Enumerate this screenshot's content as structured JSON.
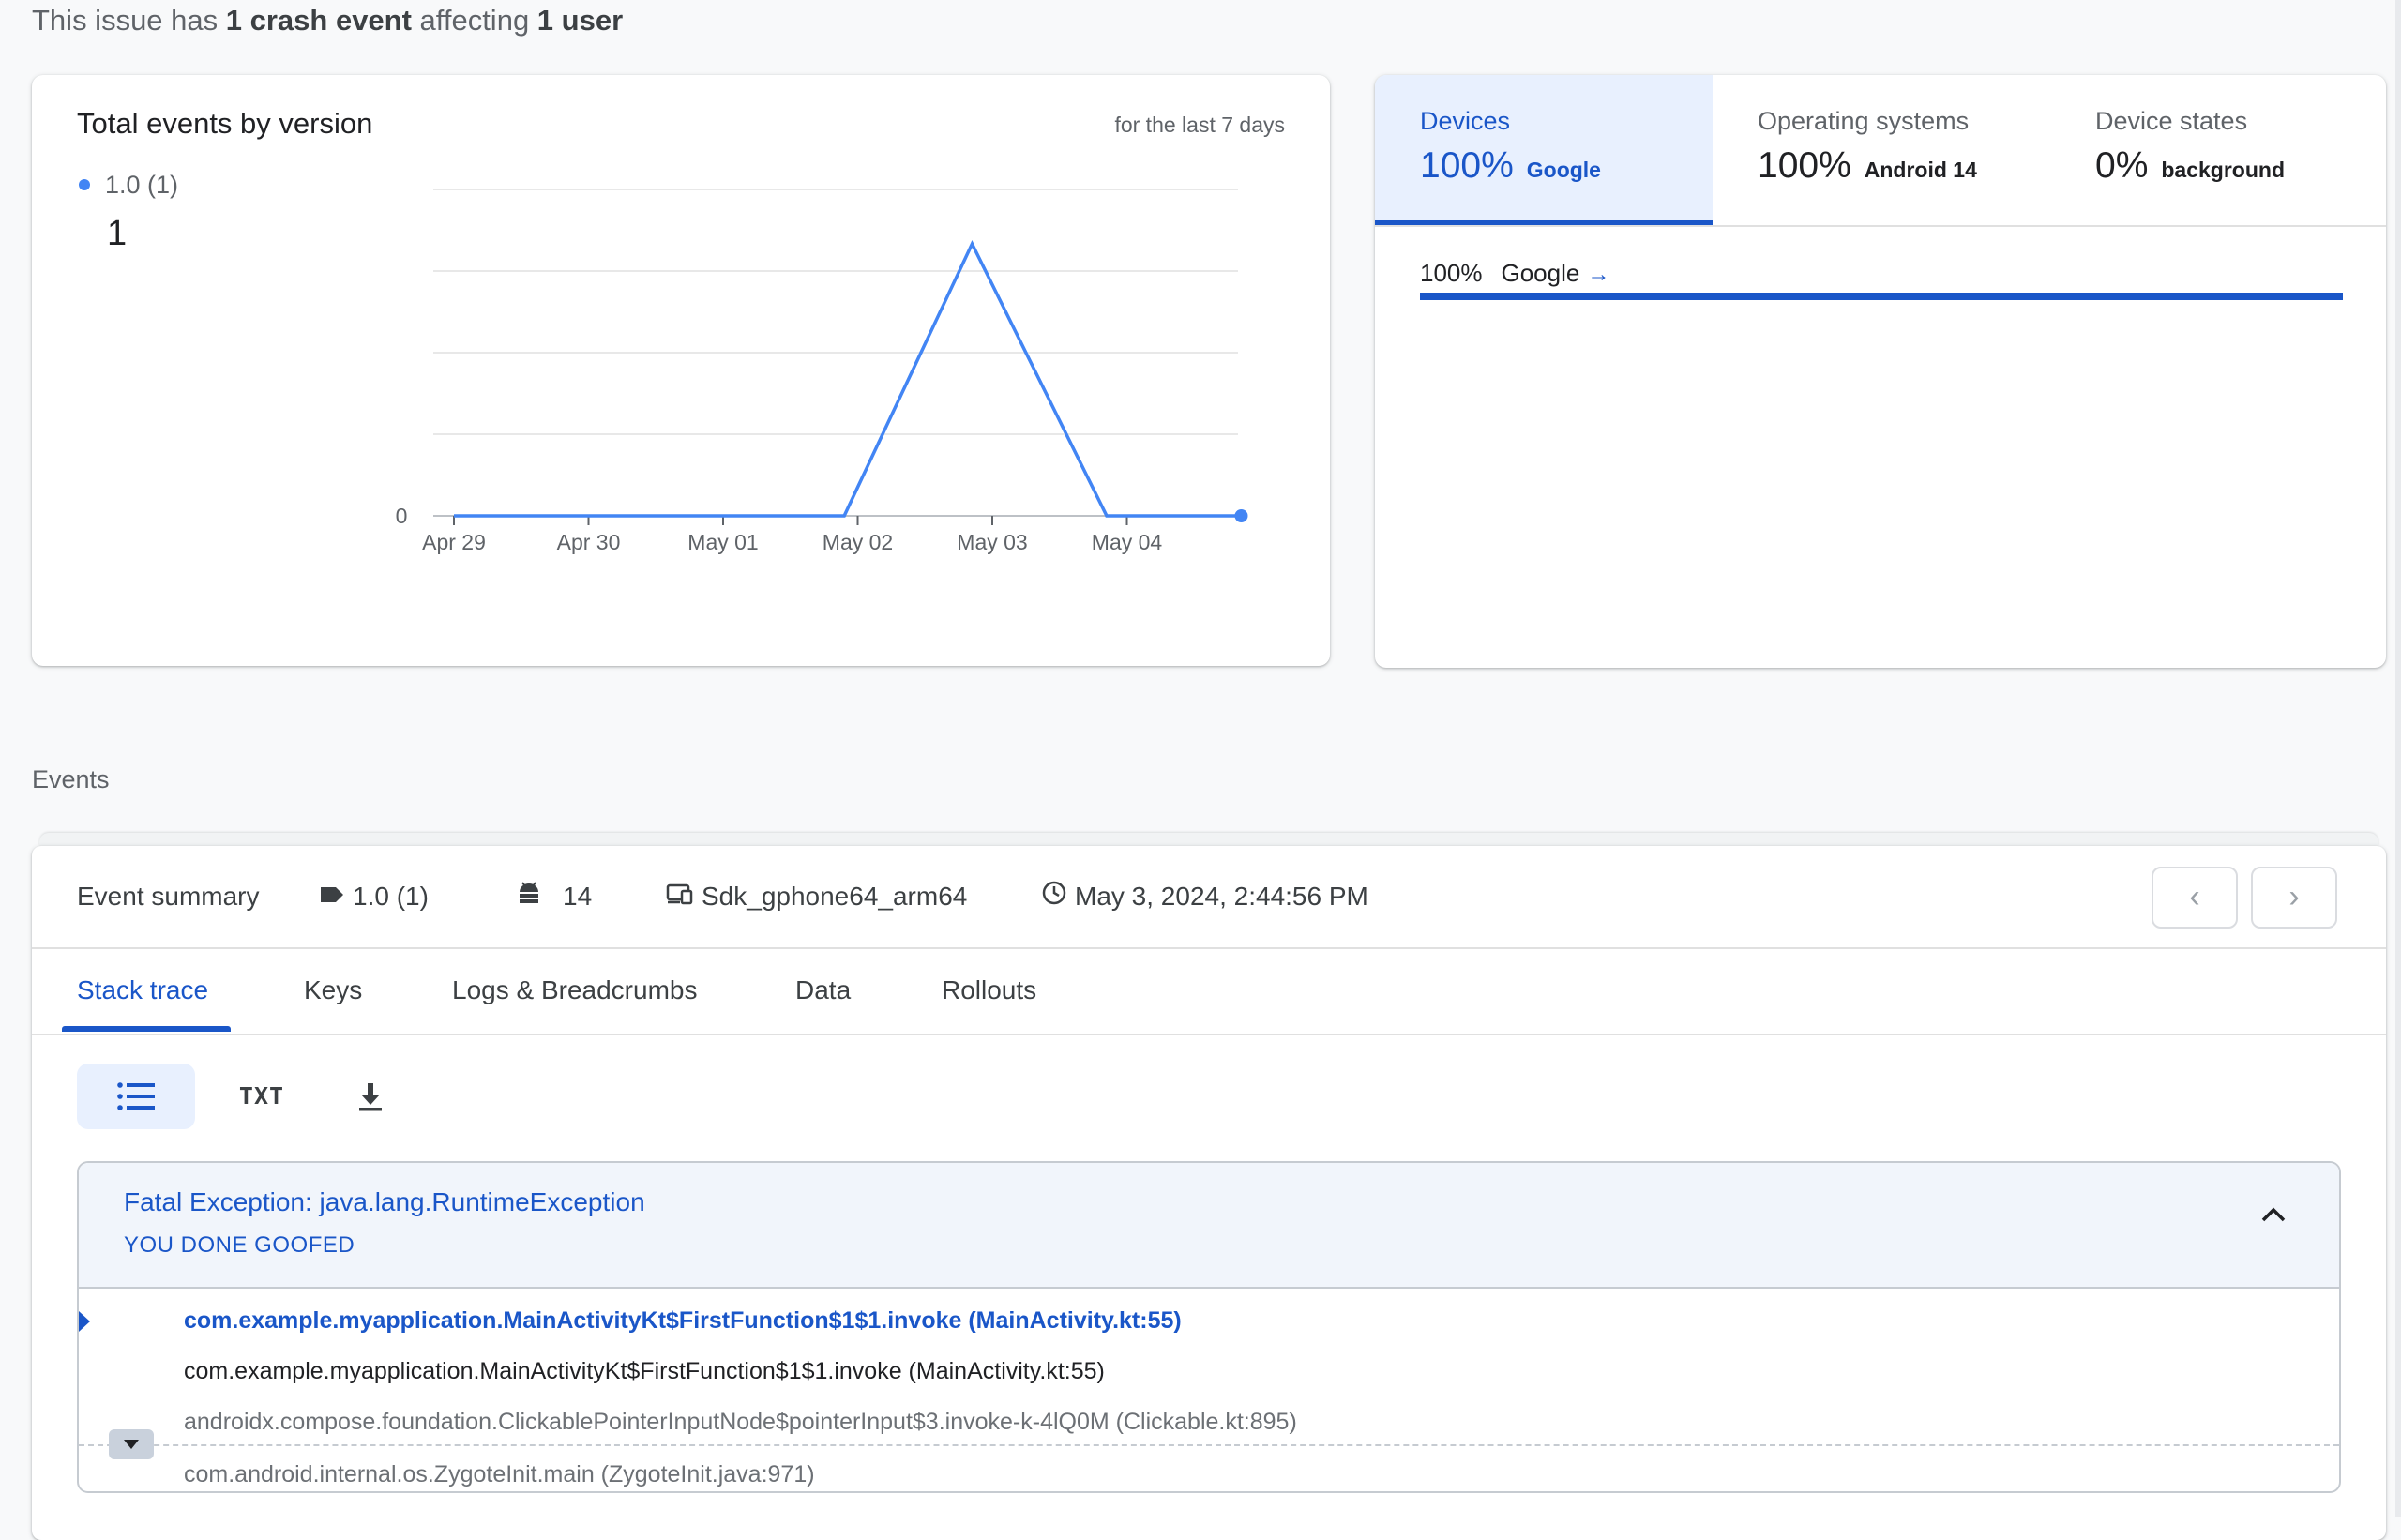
{
  "summary": {
    "prefix": "This issue has ",
    "events": "1 crash event",
    "middle": " affecting ",
    "users": "1 user"
  },
  "chart_card": {
    "title": "Total events by version",
    "range": "for the last 7 days",
    "legend_label": "1.0 (1)",
    "legend_value": "1"
  },
  "chart_data": {
    "type": "line",
    "title": "Total events by version",
    "categories": [
      "Apr 29",
      "Apr 30",
      "May 01",
      "May 02",
      "May 03",
      "May 04"
    ],
    "x_tick_labels": [
      "Apr 29",
      "Apr 30",
      "May 01",
      "May 02",
      "May 03",
      "May 04"
    ],
    "y_tick_labels": [
      "0"
    ],
    "series": [
      {
        "name": "1.0 (1)",
        "color": "#4285f4",
        "points": [
          {
            "x": 0,
            "y": 0
          },
          {
            "x": 1,
            "y": 0
          },
          {
            "x": 2,
            "y": 0
          },
          {
            "x": 2.9,
            "y": 0
          },
          {
            "x": 3.85,
            "y": 1
          },
          {
            "x": 4.85,
            "y": 0
          },
          {
            "x": 5.85,
            "y": 0
          }
        ]
      }
    ],
    "ylim": [
      0,
      1.2
    ],
    "grid": true,
    "legend": "top-left"
  },
  "distribution": {
    "tabs": [
      {
        "label": "Devices",
        "percent": "100%",
        "name": "Google"
      },
      {
        "label": "Operating systems",
        "percent": "100%",
        "name": "Android 14"
      },
      {
        "label": "Device states",
        "percent": "0%",
        "name": "background"
      }
    ],
    "row": {
      "percent": "100%",
      "name": "Google",
      "arrow": "→",
      "fraction": 1.0
    }
  },
  "events": {
    "heading": "Events",
    "summary": {
      "title": "Event summary",
      "version": "1.0 (1)",
      "api_level": "14",
      "device": "Sdk_gphone64_arm64",
      "time": "May 3, 2024, 2:44:56 PM"
    },
    "nav": {
      "prev": "‹",
      "next": "›"
    },
    "tabs": [
      "Stack trace",
      "Keys",
      "Logs & Breadcrumbs",
      "Data",
      "Rollouts"
    ],
    "views": {
      "txt": "TXT"
    },
    "exception": {
      "title": "Fatal Exception: java.lang.RuntimeException",
      "message": "YOU DONE GOOFED",
      "frames": [
        "com.example.myapplication.MainActivityKt$FirstFunction$1$1.invoke (MainActivity.kt:55)",
        "com.example.myapplication.MainActivityKt$FirstFunction$1$1.invoke (MainActivity.kt:55)",
        "androidx.compose.foundation.ClickablePointerInputNode$pointerInput$3.invoke-k-4lQ0M (Clickable.kt:895)",
        "com.android.internal.os.ZygoteInit.main (ZygoteInit.java:971)"
      ]
    }
  },
  "colors": {
    "accent": "#1a56c8",
    "series": "#4285f4",
    "muted": "#5f6368"
  }
}
